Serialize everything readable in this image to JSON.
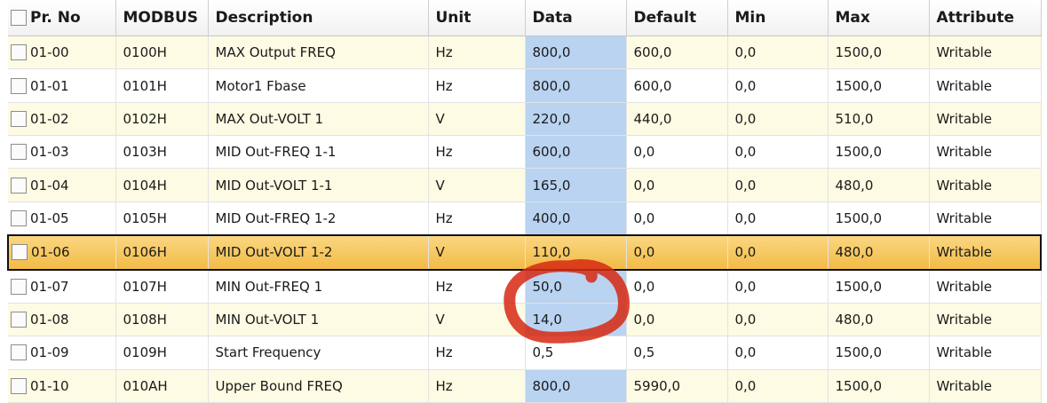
{
  "columns": [
    "Pr. No",
    "MODBUS",
    "Description",
    "Unit",
    "Data",
    "Default",
    "Min",
    "Max",
    "Attribute"
  ],
  "rows": [
    {
      "pr": "01-00",
      "modbus": "0100H",
      "desc": "MAX Output FREQ",
      "unit": "Hz",
      "data": "800,0",
      "default": "600,0",
      "min": "0,0",
      "max": "1500,0",
      "attr": "Writable",
      "data_highlight": true
    },
    {
      "pr": "01-01",
      "modbus": "0101H",
      "desc": "Motor1 Fbase",
      "unit": "Hz",
      "data": "800,0",
      "default": "600,0",
      "min": "0,0",
      "max": "1500,0",
      "attr": "Writable",
      "data_highlight": true
    },
    {
      "pr": "01-02",
      "modbus": "0102H",
      "desc": "MAX Out-VOLT 1",
      "unit": "V",
      "data": "220,0",
      "default": "440,0",
      "min": "0,0",
      "max": "510,0",
      "attr": "Writable",
      "data_highlight": true
    },
    {
      "pr": "01-03",
      "modbus": "0103H",
      "desc": "MID Out-FREQ 1-1",
      "unit": "Hz",
      "data": "600,0",
      "default": "0,0",
      "min": "0,0",
      "max": "1500,0",
      "attr": "Writable",
      "data_highlight": true
    },
    {
      "pr": "01-04",
      "modbus": "0104H",
      "desc": "MID Out-VOLT 1-1",
      "unit": "V",
      "data": "165,0",
      "default": "0,0",
      "min": "0,0",
      "max": "480,0",
      "attr": "Writable",
      "data_highlight": true
    },
    {
      "pr": "01-05",
      "modbus": "0105H",
      "desc": "MID Out-FREQ 1-2",
      "unit": "Hz",
      "data": "400,0",
      "default": "0,0",
      "min": "0,0",
      "max": "1500,0",
      "attr": "Writable",
      "data_highlight": true
    },
    {
      "pr": "01-06",
      "modbus": "0106H",
      "desc": "MID Out-VOLT 1-2",
      "unit": "V",
      "data": "110,0",
      "default": "0,0",
      "min": "0,0",
      "max": "480,0",
      "attr": "Writable",
      "data_highlight": true,
      "selected": true
    },
    {
      "pr": "01-07",
      "modbus": "0107H",
      "desc": "MIN Out-FREQ 1",
      "unit": "Hz",
      "data": "50,0",
      "default": "0,0",
      "min": "0,0",
      "max": "1500,0",
      "attr": "Writable",
      "data_highlight": true
    },
    {
      "pr": "01-08",
      "modbus": "0108H",
      "desc": "MIN Out-VOLT 1",
      "unit": "V",
      "data": "14,0",
      "default": "0,0",
      "min": "0,0",
      "max": "480,0",
      "attr": "Writable",
      "data_highlight": true
    },
    {
      "pr": "01-09",
      "modbus": "0109H",
      "desc": "Start Frequency",
      "unit": "Hz",
      "data": "0,5",
      "default": "0,5",
      "min": "0,0",
      "max": "1500,0",
      "attr": "Writable",
      "data_highlight": false
    },
    {
      "pr": "01-10",
      "modbus": "010AH",
      "desc": "Upper Bound FREQ",
      "unit": "Hz",
      "data": "800,0",
      "default": "5990,0",
      "min": "0,0",
      "max": "1500,0",
      "attr": "Writable",
      "data_highlight": true
    }
  ],
  "colors": {
    "data_highlight": "#b9d3f1",
    "row_odd": "#fdfbe3",
    "row_even": "#ffffff",
    "selected_row": "#f5c35a",
    "annotation_circle": "#d62a14"
  },
  "annotation": {
    "shape": "hand-drawn-circle",
    "around": "data values of rows 01-07 and 01-08"
  }
}
